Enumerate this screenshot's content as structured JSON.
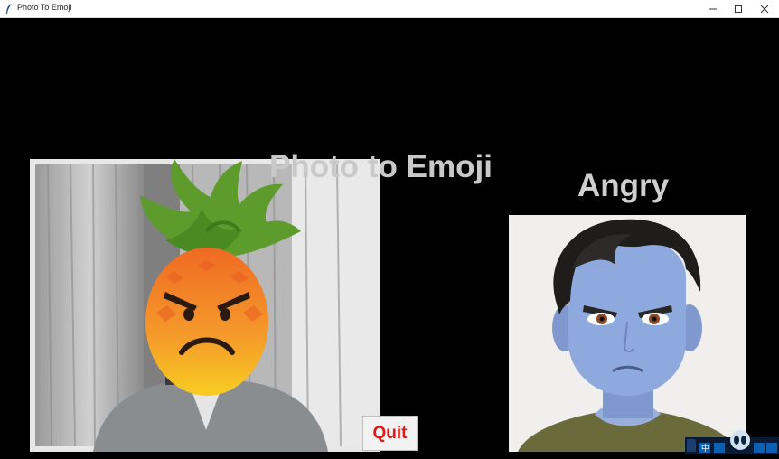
{
  "window": {
    "title": "Photo To Emoji",
    "controls": [
      "minimize",
      "maximize",
      "close"
    ]
  },
  "app": {
    "heading": "Photo to Emoji",
    "emotion_label": "Angry",
    "quit_label": "Quit"
  },
  "panels": {
    "webcam_icon": "angry-pineapple-emoji",
    "avatar_icon": "angry-cartoon-avatar"
  },
  "tray": {
    "input_label": "中"
  },
  "colors": {
    "background": "#000000",
    "heading_text": "#c9c9c9",
    "quit_text": "#e11818",
    "avatar_skin": "#8ea9de"
  }
}
